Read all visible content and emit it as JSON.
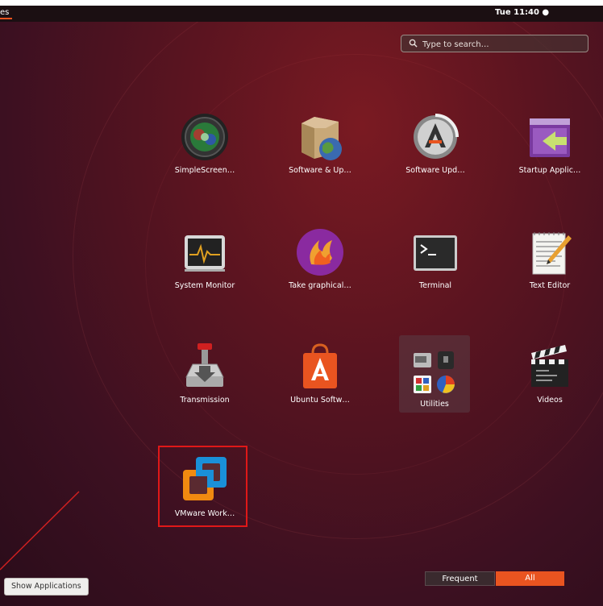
{
  "topbar": {
    "activities_label": "es",
    "clock": "Tue 11:40 ●"
  },
  "search": {
    "placeholder": "Type to search…"
  },
  "apps": [
    {
      "label": "SimpleScreen…",
      "icon": "simplescreenrecorder-icon"
    },
    {
      "label": "Software & Up…",
      "icon": "software-updates-icon"
    },
    {
      "label": "Software Upd…",
      "icon": "software-updater-icon"
    },
    {
      "label": "Startup Applic…",
      "icon": "startup-applications-icon"
    },
    {
      "label": "System Monitor",
      "icon": "system-monitor-icon"
    },
    {
      "label": "Take graphical…",
      "icon": "screenshot-tool-icon"
    },
    {
      "label": "Terminal",
      "icon": "terminal-icon"
    },
    {
      "label": "Text Editor",
      "icon": "text-editor-icon"
    },
    {
      "label": "Transmission",
      "icon": "transmission-icon"
    },
    {
      "label": "Ubuntu Softw…",
      "icon": "ubuntu-software-icon"
    },
    {
      "label": "Utilities",
      "icon": "utilities-folder-icon"
    },
    {
      "label": "Videos",
      "icon": "videos-icon"
    },
    {
      "label": "VMware Work…",
      "icon": "vmware-workstation-icon"
    }
  ],
  "bottom": {
    "show_applications": "Show Applications",
    "frequent": "Frequent",
    "all": "All"
  },
  "colors": {
    "accent": "#e95420",
    "highlight": "#e01818"
  }
}
